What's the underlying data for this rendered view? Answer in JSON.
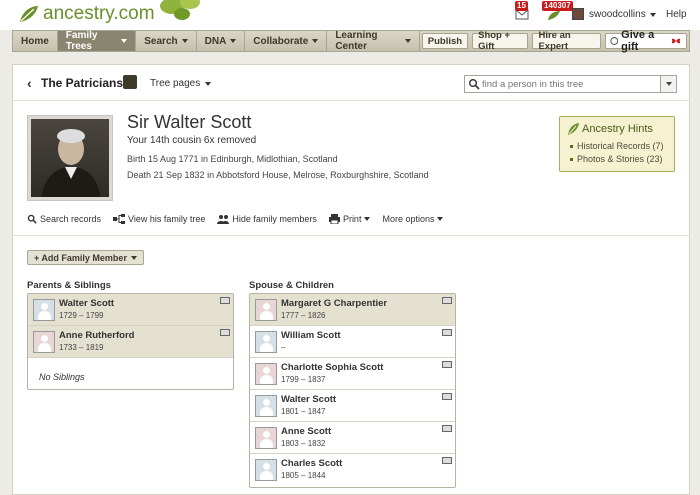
{
  "header": {
    "logo_text": "ancestry.com",
    "messages_count": "15",
    "hints_count": "140307",
    "username": "swoodcollins",
    "help_label": "Help"
  },
  "nav": {
    "items": [
      {
        "label": "Home",
        "dropdown": false
      },
      {
        "label": "Family Trees",
        "dropdown": true,
        "active": true
      },
      {
        "label": "Search",
        "dropdown": true
      },
      {
        "label": "DNA",
        "dropdown": true
      },
      {
        "label": "Collaborate",
        "dropdown": true
      },
      {
        "label": "Learning Center",
        "dropdown": true
      }
    ],
    "buttons": [
      "Publish",
      "Shop + Gift",
      "Hire an Expert"
    ],
    "gift_label": "Give a gift"
  },
  "tree": {
    "name": "The Patricians!",
    "pages_label": "Tree pages",
    "search_placeholder": "find a person in this tree"
  },
  "person": {
    "name": "Sir Walter Scott",
    "relationship": "Your 14th cousin 6x removed",
    "birth": "Birth 15 Aug 1771 in Edinburgh, Midlothian, Scotland",
    "death": "Death 21 Sep 1832 in Abbotsford House, Melrose, Roxburghshire, Scotland"
  },
  "hints": {
    "title": "Ancestry Hints",
    "items": [
      "Historical Records (7)",
      "Photos & Stories (23)"
    ]
  },
  "actions": {
    "search_records": "Search records",
    "view_tree": "View his family tree",
    "hide_family": "Hide family members",
    "print": "Print",
    "more": "More options"
  },
  "add_family_label": "+ Add Family Member",
  "parents": {
    "title": "Parents & Siblings",
    "people": [
      {
        "name": "Walter Scott",
        "dates": "1729 – 1799",
        "gender": "m"
      },
      {
        "name": "Anne Rutherford",
        "dates": "1733 – 1819",
        "gender": "f"
      }
    ],
    "no_siblings": "No Siblings"
  },
  "spouse": {
    "title": "Spouse & Children",
    "spouse": {
      "name": "Margaret G Charpentier",
      "dates": "1777 – 1826",
      "gender": "f"
    },
    "children": [
      {
        "name": "William Scott",
        "dates": "–",
        "gender": "m"
      },
      {
        "name": "Charlotte Sophia Scott",
        "dates": "1799 – 1837",
        "gender": "f"
      },
      {
        "name": "Walter Scott",
        "dates": "1801 – 1847",
        "gender": "m"
      },
      {
        "name": "Anne Scott",
        "dates": "1803 – 1832",
        "gender": "f"
      },
      {
        "name": "Charles Scott",
        "dates": "1805 – 1844",
        "gender": "m"
      }
    ]
  },
  "colors": {
    "brand_green": "#6b8f2c",
    "nav_active": "#8a8570",
    "badge_red": "#c81c1c"
  }
}
